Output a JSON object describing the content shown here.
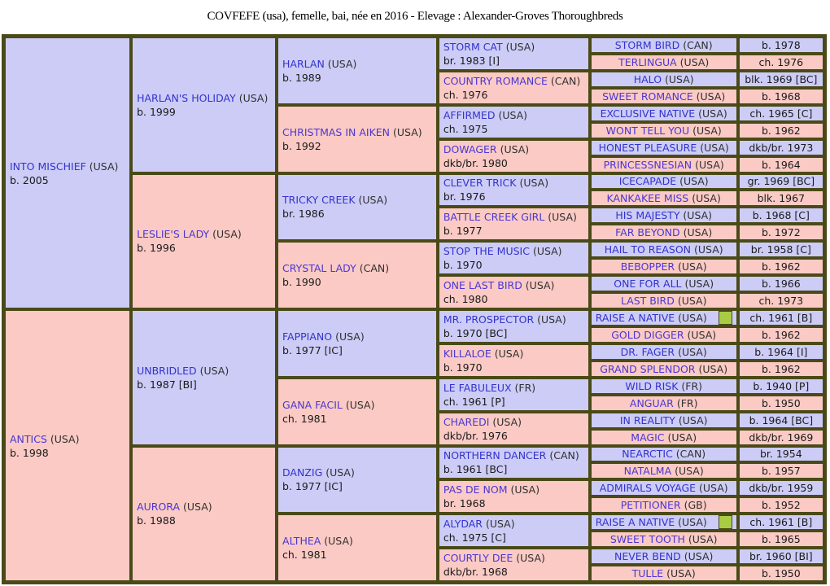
{
  "title": "COVFEFE (usa), femelle, bai, née en 2016 - Elevage : Alexander-Groves Thoroughbreds",
  "colors": {
    "sire_bg": "#ccccf7",
    "dam_bg": "#fbcac4",
    "border": "#4a4a18",
    "name_text": "#3333cc",
    "marker_green": "#aacc44"
  },
  "generation1": [
    {
      "name": "INTO MISCHIEF",
      "country": "(USA)",
      "year": "b. 2005",
      "type": "sire"
    },
    {
      "name": "ANTICS",
      "country": "(USA)",
      "year": "b. 1998",
      "type": "dam"
    }
  ],
  "generation2": [
    {
      "name": "HARLAN'S HOLIDAY",
      "country": "(USA)",
      "year": "b. 1999",
      "type": "sire"
    },
    {
      "name": "LESLIE'S LADY",
      "country": "(USA)",
      "year": "b. 1996",
      "type": "dam"
    },
    {
      "name": "UNBRIDLED",
      "country": "(USA)",
      "year": "b. 1987 [BI]",
      "type": "sire"
    },
    {
      "name": "AURORA",
      "country": "(USA)",
      "year": "b. 1988",
      "type": "dam"
    }
  ],
  "generation3": [
    {
      "name": "HARLAN",
      "country": "(USA)",
      "year": "b. 1989",
      "type": "sire"
    },
    {
      "name": "CHRISTMAS IN AIKEN",
      "country": "(USA)",
      "year": "b. 1992",
      "type": "dam"
    },
    {
      "name": "TRICKY CREEK",
      "country": "(USA)",
      "year": "br. 1986",
      "type": "sire"
    },
    {
      "name": "CRYSTAL LADY",
      "country": "(CAN)",
      "year": "b. 1990",
      "type": "dam"
    },
    {
      "name": "FAPPIANO",
      "country": "(USA)",
      "year": "b. 1977 [IC]",
      "type": "sire"
    },
    {
      "name": "GANA FACIL",
      "country": "(USA)",
      "year": "ch. 1981",
      "type": "dam"
    },
    {
      "name": "DANZIG",
      "country": "(USA)",
      "year": "b. 1977 [IC]",
      "type": "sire"
    },
    {
      "name": "ALTHEA",
      "country": "(USA)",
      "year": "ch. 1981",
      "type": "dam"
    }
  ],
  "generation4": [
    {
      "name": "STORM CAT",
      "country": "(USA)",
      "year": "br. 1983 [I]",
      "type": "sire"
    },
    {
      "name": "COUNTRY ROMANCE",
      "country": "(CAN)",
      "year": "ch. 1976",
      "type": "dam"
    },
    {
      "name": "AFFIRMED",
      "country": "(USA)",
      "year": "ch. 1975",
      "type": "sire"
    },
    {
      "name": "DOWAGER",
      "country": "(USA)",
      "year": "dkb/br. 1980",
      "type": "dam"
    },
    {
      "name": "CLEVER TRICK",
      "country": "(USA)",
      "year": "br. 1976",
      "type": "sire"
    },
    {
      "name": "BATTLE CREEK GIRL",
      "country": "(USA)",
      "year": "b. 1977",
      "type": "dam"
    },
    {
      "name": "STOP THE MUSIC",
      "country": "(USA)",
      "year": "b. 1970",
      "type": "sire"
    },
    {
      "name": "ONE LAST BIRD",
      "country": "(USA)",
      "year": "ch. 1980",
      "type": "dam"
    },
    {
      "name": "MR. PROSPECTOR",
      "country": "(USA)",
      "year": "b. 1970 [BC]",
      "type": "sire"
    },
    {
      "name": "KILLALOE",
      "country": "(USA)",
      "year": "b. 1970",
      "type": "dam"
    },
    {
      "name": "LE FABULEUX",
      "country": "(FR)",
      "year": "ch. 1961 [P]",
      "type": "sire"
    },
    {
      "name": "CHAREDI",
      "country": "(USA)",
      "year": "dkb/br. 1976",
      "type": "dam"
    },
    {
      "name": "NORTHERN DANCER",
      "country": "(CAN)",
      "year": "b. 1961 [BC]",
      "type": "sire"
    },
    {
      "name": "PAS DE NOM",
      "country": "(USA)",
      "year": "br. 1968",
      "type": "dam"
    },
    {
      "name": "ALYDAR",
      "country": "(USA)",
      "year": "ch. 1975 [C]",
      "type": "sire"
    },
    {
      "name": "COURTLY DEE",
      "country": "(USA)",
      "year": "dkb/br. 1968",
      "type": "dam"
    }
  ],
  "generation5": [
    {
      "name": "STORM BIRD",
      "country": "(CAN)",
      "year": "b. 1978",
      "type": "sire",
      "marker": false
    },
    {
      "name": "TERLINGUA",
      "country": "(USA)",
      "year": "ch. 1976",
      "type": "dam",
      "marker": false
    },
    {
      "name": "HALO",
      "country": "(USA)",
      "year": "blk. 1969 [BC]",
      "type": "sire",
      "marker": false
    },
    {
      "name": "SWEET ROMANCE",
      "country": "(USA)",
      "year": "b. 1968",
      "type": "dam",
      "marker": false
    },
    {
      "name": "EXCLUSIVE NATIVE",
      "country": "(USA)",
      "year": "ch. 1965 [C]",
      "type": "sire",
      "marker": false
    },
    {
      "name": "WONT TELL YOU",
      "country": "(USA)",
      "year": "b. 1962",
      "type": "dam",
      "marker": false
    },
    {
      "name": "HONEST PLEASURE",
      "country": "(USA)",
      "year": "dkb/br. 1973",
      "type": "sire",
      "marker": false
    },
    {
      "name": "PRINCESSNESIAN",
      "country": "(USA)",
      "year": "b. 1964",
      "type": "dam",
      "marker": false
    },
    {
      "name": "ICECAPADE",
      "country": "(USA)",
      "year": "gr. 1969 [BC]",
      "type": "sire",
      "marker": false
    },
    {
      "name": "KANKAKEE MISS",
      "country": "(USA)",
      "year": "blk. 1967",
      "type": "dam",
      "marker": false
    },
    {
      "name": "HIS MAJESTY",
      "country": "(USA)",
      "year": "b. 1968 [C]",
      "type": "sire",
      "marker": false
    },
    {
      "name": "FAR BEYOND",
      "country": "(USA)",
      "year": "b. 1972",
      "type": "dam",
      "marker": false
    },
    {
      "name": "HAIL TO REASON",
      "country": "(USA)",
      "year": "br. 1958 [C]",
      "type": "sire",
      "marker": false
    },
    {
      "name": "BEBOPPER",
      "country": "(USA)",
      "year": "b. 1962",
      "type": "dam",
      "marker": false
    },
    {
      "name": "ONE FOR ALL",
      "country": "(USA)",
      "year": "b. 1966",
      "type": "sire",
      "marker": false
    },
    {
      "name": "LAST BIRD",
      "country": "(USA)",
      "year": "ch. 1973",
      "type": "dam",
      "marker": false
    },
    {
      "name": "RAISE A NATIVE",
      "country": "(USA)",
      "year": "ch. 1961 [B]",
      "type": "sire",
      "marker": true
    },
    {
      "name": "GOLD DIGGER",
      "country": "(USA)",
      "year": "b. 1962",
      "type": "dam",
      "marker": false
    },
    {
      "name": "DR. FAGER",
      "country": "(USA)",
      "year": "b. 1964 [I]",
      "type": "sire",
      "marker": false
    },
    {
      "name": "GRAND SPLENDOR",
      "country": "(USA)",
      "year": "b. 1962",
      "type": "dam",
      "marker": false
    },
    {
      "name": "WILD RISK",
      "country": "(FR)",
      "year": "b. 1940 [P]",
      "type": "sire",
      "marker": false
    },
    {
      "name": "ANGUAR",
      "country": "(FR)",
      "year": "b. 1950",
      "type": "dam",
      "marker": false
    },
    {
      "name": "IN REALITY",
      "country": "(USA)",
      "year": "b. 1964 [BC]",
      "type": "sire",
      "marker": false
    },
    {
      "name": "MAGIC",
      "country": "(USA)",
      "year": "dkb/br. 1969",
      "type": "dam",
      "marker": false
    },
    {
      "name": "NEARCTIC",
      "country": "(CAN)",
      "year": "br. 1954",
      "type": "sire",
      "marker": false
    },
    {
      "name": "NATALMA",
      "country": "(USA)",
      "year": "b. 1957",
      "type": "dam",
      "marker": false
    },
    {
      "name": "ADMIRALS VOYAGE",
      "country": "(USA)",
      "year": "dkb/br. 1959",
      "type": "sire",
      "marker": false
    },
    {
      "name": "PETITIONER",
      "country": "(GB)",
      "year": "b. 1952",
      "type": "dam",
      "marker": false
    },
    {
      "name": "RAISE A NATIVE",
      "country": "(USA)",
      "year": "ch. 1961 [B]",
      "type": "sire",
      "marker": true
    },
    {
      "name": "SWEET TOOTH",
      "country": "(USA)",
      "year": "b. 1965",
      "type": "dam",
      "marker": false
    },
    {
      "name": "NEVER BEND",
      "country": "(USA)",
      "year": "br. 1960 [BI]",
      "type": "sire",
      "marker": false
    },
    {
      "name": "TULLE",
      "country": "(USA)",
      "year": "b. 1950",
      "type": "dam",
      "marker": false
    }
  ]
}
